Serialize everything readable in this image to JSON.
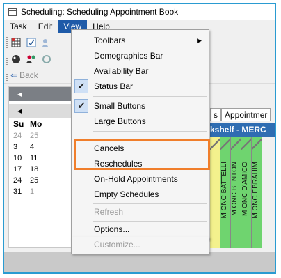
{
  "window": {
    "title": "Scheduling: Scheduling Appointment Book"
  },
  "menubar": {
    "items": [
      "Task",
      "Edit",
      "View",
      "Help"
    ],
    "active": "View"
  },
  "toolbar": {
    "back_label": "Back"
  },
  "calendar": {
    "days_header": [
      "Su",
      "Mo"
    ],
    "rows": [
      [
        "24",
        "25"
      ],
      [
        "3",
        "4"
      ],
      [
        "10",
        "11"
      ],
      [
        "17",
        "18"
      ],
      [
        "24",
        "25"
      ],
      [
        "31",
        "1"
      ]
    ]
  },
  "tabs": {
    "tab1": "s",
    "tab2": "Appointmer"
  },
  "band": {
    "text": "kshelf - MERC"
  },
  "columns": [
    "",
    "M ONC BATTELLI",
    "M ONC BENTON",
    "M ONC D'AMICO",
    "M ONC EBRAHIM"
  ],
  "view_menu": {
    "items": {
      "toolbars": "Toolbars",
      "demographics_bar": "Demographics Bar",
      "availability_bar": "Availability Bar",
      "status_bar": "Status Bar",
      "small_buttons": "Small Buttons",
      "large_buttons": "Large Buttons",
      "cancels": "Cancels",
      "reschedules": "Reschedules",
      "on_hold": "On-Hold Appointments",
      "empty_schedules": "Empty Schedules",
      "refresh": "Refresh",
      "options": "Options...",
      "customize": "Customize..."
    },
    "checked_mark": "✔",
    "submenu_arrow": "▶"
  },
  "colors": {
    "menu_highlight": "#1e5aa8",
    "callout": "#f07e2b",
    "frame": "#2a9bd1"
  }
}
